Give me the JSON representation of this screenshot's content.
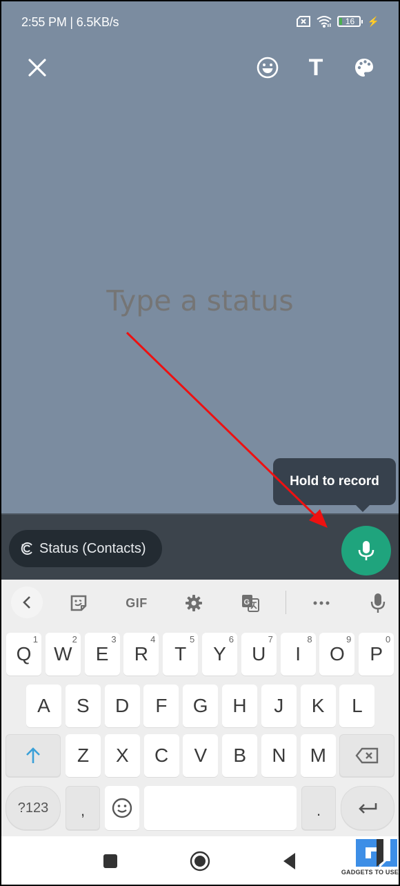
{
  "status_bar": {
    "time_speed": "2:55 PM | 6.5KB/s",
    "battery_level": "16",
    "icons": [
      "sim-missing-icon",
      "wifi-icon",
      "battery-icon",
      "charging-icon"
    ],
    "battery_fill_color": "#4caf50"
  },
  "top_actions": {
    "close": "close-icon",
    "emoji": "emoji-icon",
    "text": "T",
    "palette": "palette-icon"
  },
  "composer": {
    "placeholder": "Type a status",
    "background_color": "#7b8ca0"
  },
  "tooltip": {
    "text": "Hold to record"
  },
  "bottom_bar": {
    "privacy_label": "Status (Contacts)",
    "mic_color": "#1fa47d"
  },
  "keyboard": {
    "toolbar": [
      "back",
      "sticker",
      "GIF",
      "settings",
      "translate",
      "more",
      "voice"
    ],
    "gif_label": "GIF",
    "row1": [
      {
        "k": "Q",
        "h": "1"
      },
      {
        "k": "W",
        "h": "2"
      },
      {
        "k": "E",
        "h": "3"
      },
      {
        "k": "R",
        "h": "4"
      },
      {
        "k": "T",
        "h": "5"
      },
      {
        "k": "Y",
        "h": "6"
      },
      {
        "k": "U",
        "h": "7"
      },
      {
        "k": "I",
        "h": "8"
      },
      {
        "k": "O",
        "h": "9"
      },
      {
        "k": "P",
        "h": "0"
      }
    ],
    "row2": [
      "A",
      "S",
      "D",
      "F",
      "G",
      "H",
      "J",
      "K",
      "L"
    ],
    "row3": [
      "Z",
      "X",
      "C",
      "V",
      "B",
      "N",
      "M"
    ],
    "symbols_label": "?123",
    "comma": ",",
    "period": ".",
    "shift_color": "#3aa0d8"
  },
  "watermark": {
    "text": "GADGETS TO USE"
  }
}
